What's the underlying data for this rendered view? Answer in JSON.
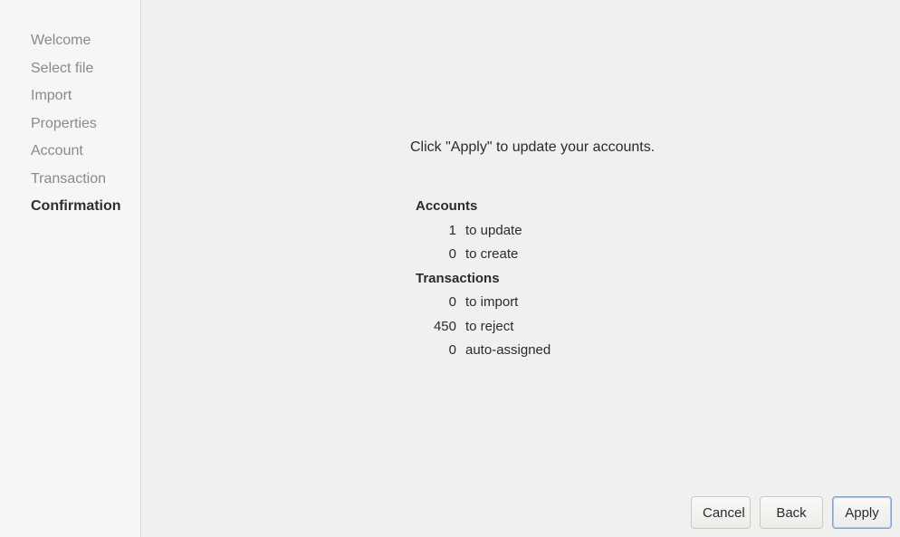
{
  "sidebar": {
    "steps": [
      {
        "label": "Welcome"
      },
      {
        "label": "Select file"
      },
      {
        "label": "Import"
      },
      {
        "label": "Properties"
      },
      {
        "label": "Account"
      },
      {
        "label": "Transaction"
      },
      {
        "label": "Confirmation"
      }
    ],
    "current_step": "Confirmation"
  },
  "main": {
    "intro": "Click \"Apply\" to update your accounts.",
    "accounts": {
      "heading": "Accounts",
      "rows": [
        {
          "count": "1",
          "label": "to update"
        },
        {
          "count": "0",
          "label": "to create"
        }
      ]
    },
    "transactions": {
      "heading": "Transactions",
      "rows": [
        {
          "count": "0",
          "label": "to import"
        },
        {
          "count": "450",
          "label": "to reject"
        },
        {
          "count": "0",
          "label": "auto-assigned"
        }
      ]
    }
  },
  "buttons": {
    "cancel": "Cancel",
    "back": "Back",
    "apply": "Apply"
  },
  "colors": {
    "sidebar_inactive_text": "#8a8a88",
    "sidebar_active_text": "#2e2e2e",
    "default_button_border": "#7ea3cf"
  }
}
